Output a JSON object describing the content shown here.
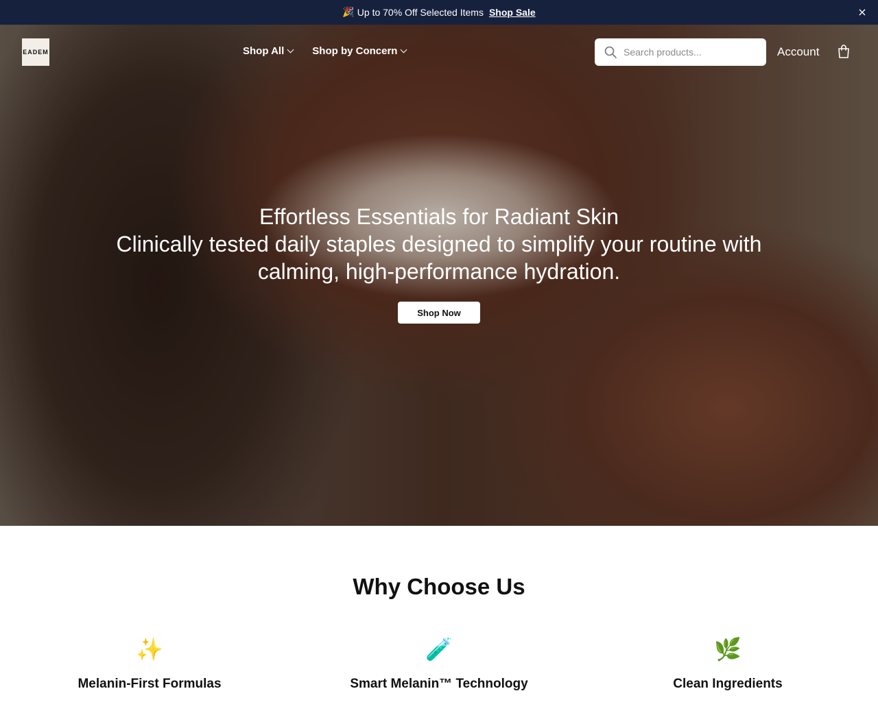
{
  "announcement": {
    "emoji": "🎉",
    "text": "Up to 70% Off Selected Items",
    "link_label": "Shop Sale",
    "close_glyph": "×"
  },
  "header": {
    "logo_text": "EADEM",
    "nav": [
      {
        "label": "Shop All"
      },
      {
        "label": "Shop by Concern"
      }
    ],
    "search_placeholder": "Search products...",
    "account_label": "Account"
  },
  "hero": {
    "title": "Effortless Essentials for Radiant Skin",
    "subtitle": "Clinically tested daily staples designed to simplify your routine with calming, high-performance hydration.",
    "cta_label": "Shop Now"
  },
  "why": {
    "title": "Why Choose Us",
    "features": [
      {
        "icon": "✨",
        "title": "Melanin-First Formulas"
      },
      {
        "icon": "🧪",
        "title": "Smart Melanin™ Technology"
      },
      {
        "icon": "🌿",
        "title": "Clean Ingredients"
      }
    ]
  },
  "colors": {
    "announcement_bg": "#16213e",
    "accent": "#ffffff"
  }
}
